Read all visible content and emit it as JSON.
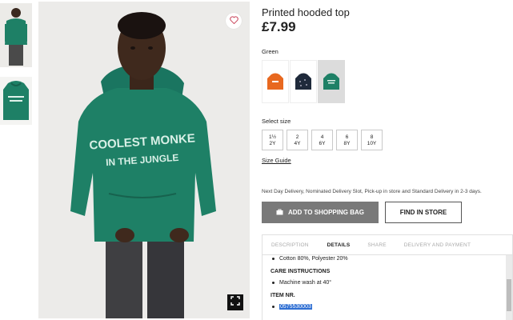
{
  "product": {
    "title": "Printed hooded top",
    "price": "£7.99",
    "hoodie_text_line1": "COOLEST MONKE",
    "hoodie_text_line2": "IN THE JUNGLE"
  },
  "color": {
    "label": "Green",
    "swatches": [
      {
        "name": "orange",
        "color": "#e8681f"
      },
      {
        "name": "navy",
        "color": "#1f2a3b"
      },
      {
        "name": "green",
        "color": "#1e8066"
      }
    ],
    "selected_index": 2
  },
  "size": {
    "label": "Select size",
    "options": [
      {
        "l1": "1½",
        "l2": "2Y"
      },
      {
        "l1": "2",
        "l2": "4Y"
      },
      {
        "l1": "4",
        "l2": "6Y"
      },
      {
        "l1": "6",
        "l2": "8Y"
      },
      {
        "l1": "8",
        "l2": "10Y"
      }
    ],
    "guide": "Size Guide"
  },
  "delivery_text": "Next Day Delivery, Nominated Delivery Slot, Pick-up in store and Standard Delivery in 2-3 days.",
  "buttons": {
    "add_to_bag": "ADD TO SHOPPING BAG",
    "find_in_store": "FIND IN STORE"
  },
  "tabs": [
    "DESCRIPTION",
    "DETAILS",
    "SHARE",
    "DELIVERY AND PAYMENT"
  ],
  "active_tab": "DETAILS",
  "details": {
    "composition": "Cotton 80%, Polyester 20%",
    "care_heading": "CARE INSTRUCTIONS",
    "care_item": "Machine wash at 40°",
    "item_nr_heading": "ITEM NR.",
    "item_nr": "0575530003"
  },
  "colors": {
    "hoodie": "#1e8066",
    "button_gray": "#797979",
    "highlight": "#2f6fd3"
  }
}
